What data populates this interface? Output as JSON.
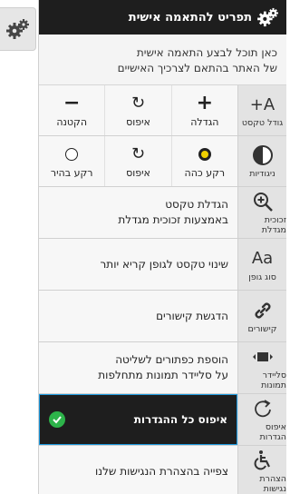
{
  "header": {
    "title": "תפריט להתאמה אישית"
  },
  "intro": {
    "line1": "כאן תוכל לבצע התאמה אישית",
    "line2": "של האתר בהתאם לצרכיך האישיים"
  },
  "text_size": {
    "icon_glyph": "A+",
    "label": "גודל טקסט",
    "buttons": [
      {
        "symbol": "+",
        "label": "הגדלה"
      },
      {
        "symbol": "↻",
        "label": "איפוס"
      },
      {
        "symbol": "−",
        "label": "הקטנה"
      }
    ]
  },
  "contrast": {
    "label": "ניגודיות",
    "buttons": [
      {
        "label": "רקע כהה"
      },
      {
        "label": "איפוס"
      },
      {
        "label": "רקע בהיר"
      }
    ]
  },
  "magnifier": {
    "label": "זכוכית מגדלת",
    "text1": "הגדלת טקסט",
    "text2": "באמצעות זכוכית מגדלת"
  },
  "font": {
    "icon_glyph": "Aa",
    "label": "סוג גופן",
    "text": "שינוי טקסט לגופן קריא יותר"
  },
  "links": {
    "label": "קישורים",
    "text": "הדגשת קישורים"
  },
  "slider": {
    "label": "סליידר תמונות",
    "text1": "הוספת כפתורים לשליטה",
    "text2": "על סליידר תמונות מתחלפות"
  },
  "reset": {
    "label": "איפוס הגדרות",
    "text": "איפוס כל ההגדרות"
  },
  "statement": {
    "label": "הצהרת נגישות",
    "text": "צפייה בהצהרת הנגישות שלנו"
  },
  "colors": {
    "header_bg": "#1e1e1e",
    "active_border": "#1e9be0",
    "check": "#2db34a",
    "dark_radio": "#f0d000"
  }
}
